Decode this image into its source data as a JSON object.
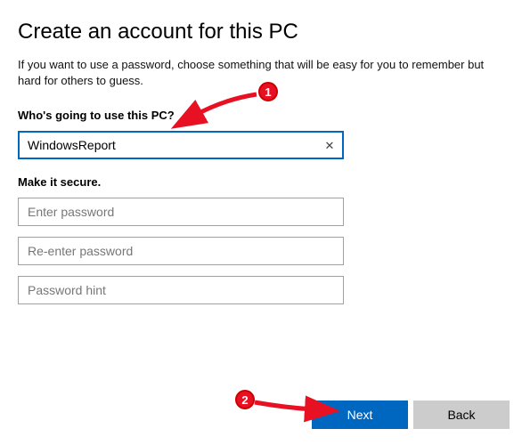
{
  "title": "Create an account for this PC",
  "subtitle": "If you want to use a password, choose something that will be easy for you to remember but hard for others to guess.",
  "section_user": {
    "label": "Who's going to use this PC?",
    "username_value": "WindowsReport"
  },
  "section_secure": {
    "label": "Make it secure.",
    "password_placeholder": "Enter password",
    "reenter_placeholder": "Re-enter password",
    "hint_placeholder": "Password hint"
  },
  "buttons": {
    "next": "Next",
    "back": "Back"
  },
  "annotations": {
    "badge1": "1",
    "badge2": "2"
  }
}
